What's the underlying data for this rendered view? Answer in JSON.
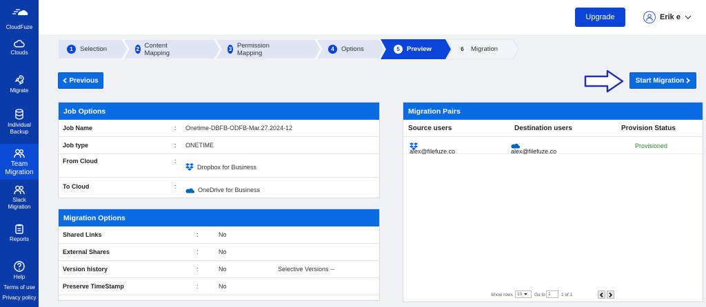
{
  "sidebar": {
    "brand": "CloudFuze",
    "items": [
      {
        "label": "Clouds",
        "icon": "cloud-icon"
      },
      {
        "label": "Migrate",
        "icon": "rocket-icon"
      },
      {
        "label": "Individual Backup",
        "icon": "database-icon"
      },
      {
        "label": "Team Migration",
        "icon": "users-icon"
      },
      {
        "label": "Slack Migration",
        "icon": "users-icon"
      },
      {
        "label": "Reports",
        "icon": "clipboard-icon"
      },
      {
        "label": "Help",
        "icon": "help-icon"
      }
    ],
    "terms": "Terms of use",
    "privacy": "Privacy policy"
  },
  "header": {
    "upgrade": "Upgrade",
    "user": "Erik e"
  },
  "steps": [
    {
      "num": "1",
      "label": "Selection"
    },
    {
      "num": "2",
      "label": "Content Mapping"
    },
    {
      "num": "3",
      "label": "Permission Mapping"
    },
    {
      "num": "4",
      "label": "Options"
    },
    {
      "num": "5",
      "label": "Preview"
    },
    {
      "num": "6",
      "label": "Migration"
    }
  ],
  "actions": {
    "previous": "Previous",
    "start": "Start Migration"
  },
  "job_options": {
    "title": "Job Options",
    "rows": [
      {
        "key": "Job Name",
        "value": "Onetime-DBFB-ODFB-Mar.27.2024-12"
      },
      {
        "key": "Job type",
        "value": "ONETIME"
      },
      {
        "key": "From Cloud",
        "value": "Dropbox for Business"
      },
      {
        "key": "To Cloud",
        "value": "OneDrive for Business"
      }
    ]
  },
  "migration_options": {
    "title": "Migration Options",
    "rows": [
      {
        "key": "Shared Links",
        "value": "No",
        "extra": ""
      },
      {
        "key": "External Shares",
        "value": "No",
        "extra": ""
      },
      {
        "key": "Version history",
        "value": "No",
        "extra": "Selective Versions --"
      },
      {
        "key": "Preserve TimeStamp",
        "value": "No",
        "extra": ""
      }
    ]
  },
  "migration_pairs": {
    "title": "Migration Pairs",
    "columns": [
      "Source users",
      "Destination users",
      "Provision Status"
    ],
    "rows": [
      {
        "source": "alex@filefuze.co",
        "destination": "alex@filefuze.co",
        "status": "Provisioned"
      }
    ],
    "pager": {
      "show_rows": "Show rows",
      "rows_value": "10",
      "goto": "Go to",
      "page": "1",
      "of": "1 of 1"
    }
  },
  "colors": {
    "sidebar": "#0a3ba8",
    "primary": "#0b6be0",
    "active_step": "#0b44d8",
    "provisioned": "#2e8b2e"
  }
}
